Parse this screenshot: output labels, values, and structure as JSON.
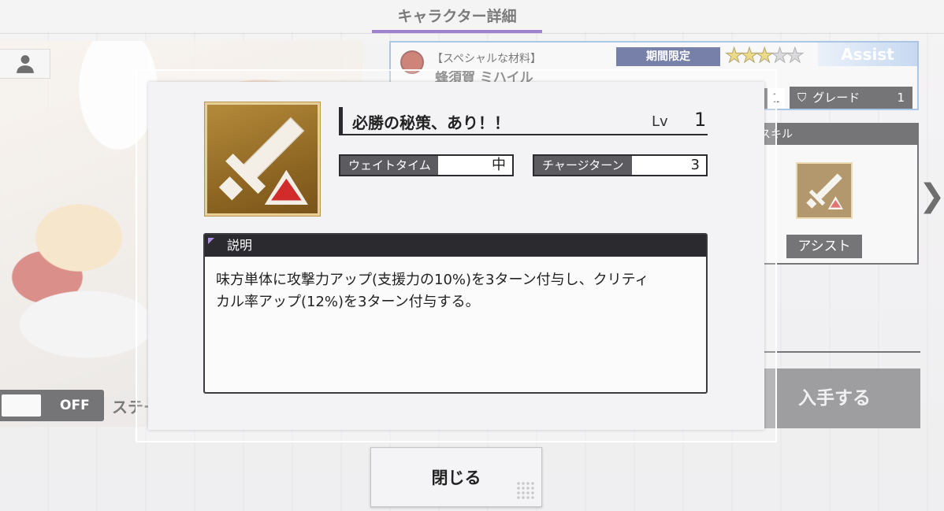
{
  "header": {
    "title": "キャラクター詳細"
  },
  "character": {
    "category": "【スペシャルな材料】",
    "name": "蜂須賀 ミハイル",
    "limited_label": "期間限定",
    "rarity": 3,
    "rarity_max": 5,
    "type_tag": "Assist",
    "level": "1",
    "grade_label": "グレード",
    "grade_value": "1"
  },
  "status_toggle": {
    "state": "OFF",
    "label": "ステータスMAX表示"
  },
  "skill_panel": {
    "title": "スキル",
    "assist_label": "アシスト"
  },
  "acquire_button": "入手する",
  "modal": {
    "skill_name": "必勝の秘策、あり！！",
    "lv_label": "Lv",
    "lv_value": "1",
    "wait_label": "ウェイトタイム",
    "wait_value": "中",
    "charge_label": "チャージターン",
    "charge_value": "3",
    "desc_title": "説明",
    "desc_line1": "味方単体に攻撃力アップ(支援力の10%)を3ターン付与し、クリティ",
    "desc_line2": "カル率アップ(12%)を3ターン付与する。",
    "close_label": "閉じる"
  },
  "colors": {
    "accent_purple": "#6a3fb4",
    "dark_panel": "#2b2b2f",
    "skill_icon_bg": "#8a6220",
    "skill_triangle": "#d22b2b"
  },
  "icons": [
    "person-icon",
    "sword-icon",
    "grade-chevron-icon",
    "chevron-right-icon",
    "star-icon"
  ]
}
